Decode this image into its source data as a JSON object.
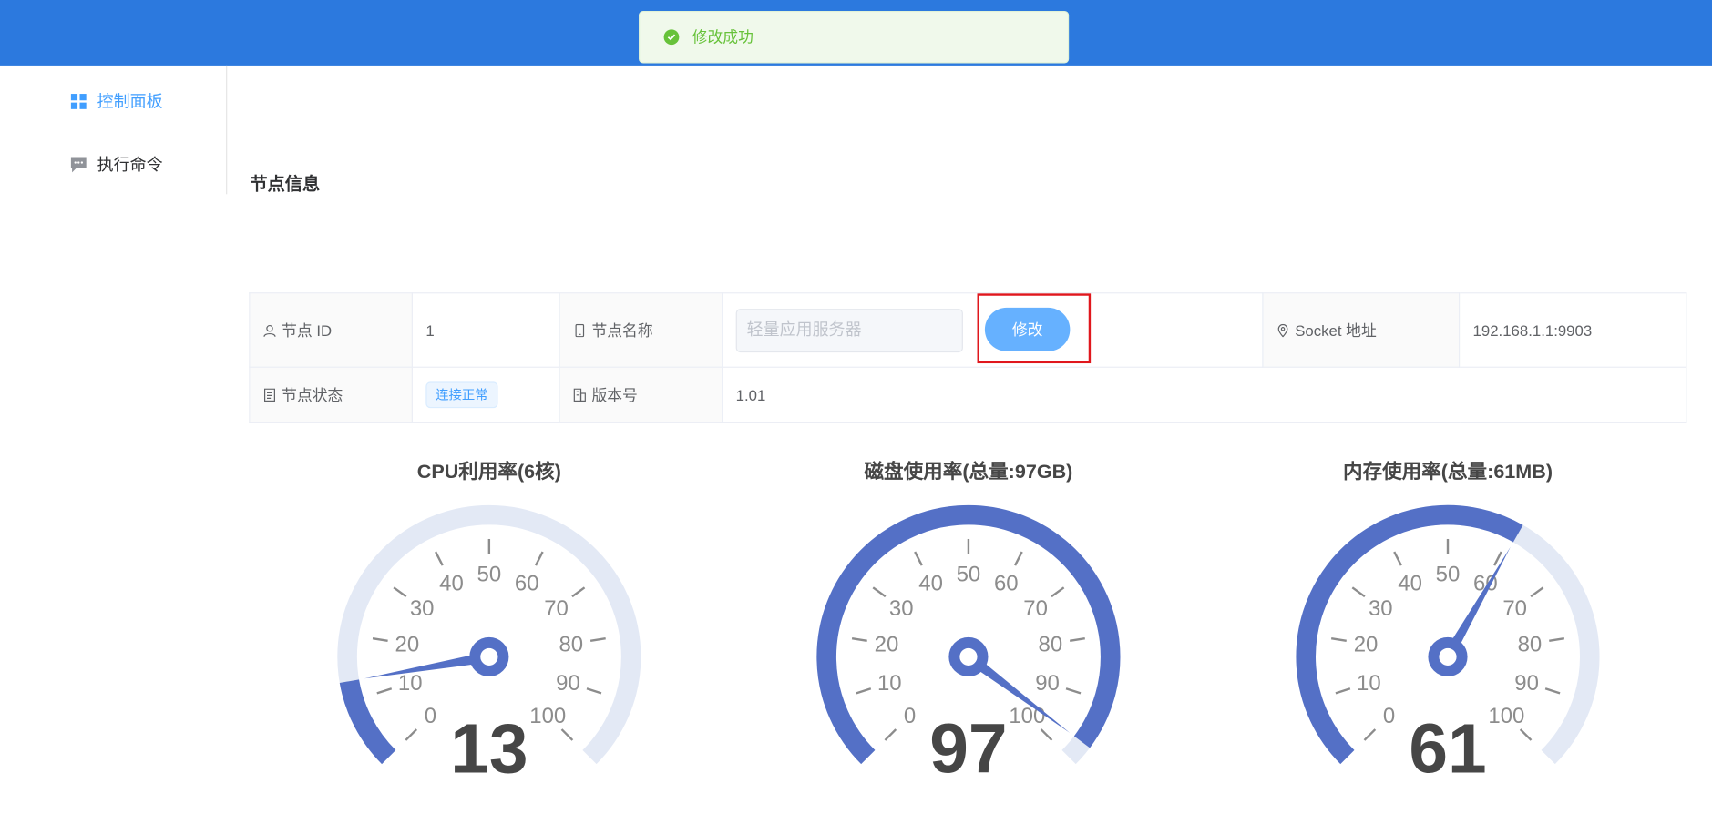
{
  "toast": {
    "message": "修改成功",
    "icon": "check-circle-icon",
    "color": "#67c23a"
  },
  "sidebar": {
    "items": [
      {
        "label": "控制面板",
        "icon": "dashboard-grid-icon",
        "active": true
      },
      {
        "label": "执行命令",
        "icon": "chat-message-icon",
        "active": false
      }
    ]
  },
  "page": {
    "title": "节点信息"
  },
  "node_info": {
    "id_label": "节点 ID",
    "id_value": "1",
    "name_label": "节点名称",
    "name_placeholder": "轻量应用服务器",
    "edit_button": "修改",
    "socket_label": "Socket 地址",
    "socket_value": "192.168.1.1:9903",
    "status_label": "节点状态",
    "status_value": "连接正常",
    "version_label": "版本号",
    "version_value": "1.01"
  },
  "gauges": [
    {
      "title": "CPU利用率(6核)",
      "value": 13
    },
    {
      "title": "磁盘使用率(总量:97GB)",
      "value": 97
    },
    {
      "title": "内存使用率(总量:61MB)",
      "value": 61
    }
  ],
  "gauge_scale": {
    "min": 0,
    "max": 100,
    "labels": [
      "0",
      "10",
      "20",
      "30",
      "40",
      "50",
      "60",
      "70",
      "80",
      "90",
      "100"
    ]
  },
  "colors": {
    "header": "#2c79de",
    "accent": "#409eff",
    "gauge_fill": "#5470c6",
    "gauge_track": "#e3e9f5",
    "highlight_border": "#e0171d"
  }
}
